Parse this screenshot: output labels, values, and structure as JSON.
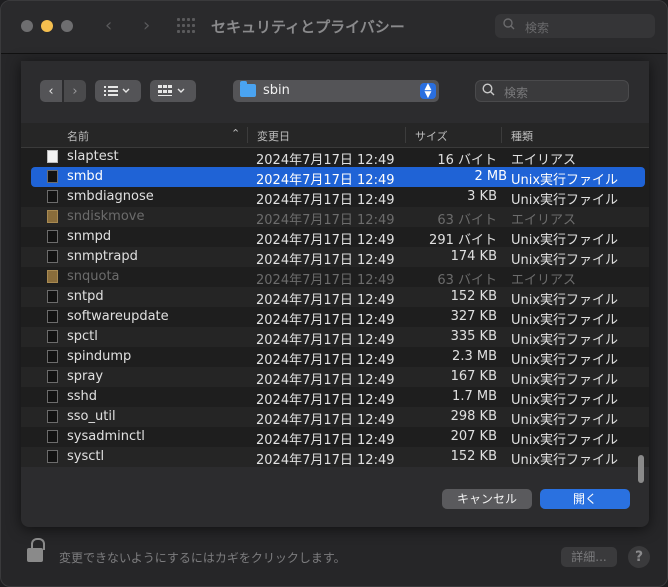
{
  "window": {
    "title": "セキュリティとプライバシー",
    "search_placeholder": "検索"
  },
  "toolbar": {
    "back_icon": "chevron-left-icon",
    "forward_icon": "chevron-right-icon",
    "list_view_icon": "list-view-icon",
    "grid_view_icon": "icon-grid-view-icon",
    "path_label": "sbin",
    "search_placeholder": "検索"
  },
  "columns": {
    "name": "名前",
    "modified": "変更日",
    "size": "サイズ",
    "kind": "種類"
  },
  "rows": [
    {
      "name": "slaptest",
      "date": "2024年7月17日 12:49",
      "size": "16 バイト",
      "kind": "エイリアス"
    },
    {
      "name": "smbd",
      "date": "2024年7月17日 12:49",
      "size": "2 MB",
      "kind": "Unix実行ファイル"
    },
    {
      "name": "smbdiagnose",
      "date": "2024年7月17日 12:49",
      "size": "3 KB",
      "kind": "Unix実行ファイル"
    },
    {
      "name": "sndiskmove",
      "date": "2024年7月17日 12:49",
      "size": "63 バイト",
      "kind": "エイリアス"
    },
    {
      "name": "snmpd",
      "date": "2024年7月17日 12:49",
      "size": "291 バイト",
      "kind": "Unix実行ファイル"
    },
    {
      "name": "snmptrapd",
      "date": "2024年7月17日 12:49",
      "size": "174 KB",
      "kind": "Unix実行ファイル"
    },
    {
      "name": "snquota",
      "date": "2024年7月17日 12:49",
      "size": "63 バイト",
      "kind": "エイリアス"
    },
    {
      "name": "sntpd",
      "date": "2024年7月17日 12:49",
      "size": "152 KB",
      "kind": "Unix実行ファイル"
    },
    {
      "name": "softwareupdate",
      "date": "2024年7月17日 12:49",
      "size": "327 KB",
      "kind": "Unix実行ファイル"
    },
    {
      "name": "spctl",
      "date": "2024年7月17日 12:49",
      "size": "335 KB",
      "kind": "Unix実行ファイル"
    },
    {
      "name": "spindump",
      "date": "2024年7月17日 12:49",
      "size": "2.3 MB",
      "kind": "Unix実行ファイル"
    },
    {
      "name": "spray",
      "date": "2024年7月17日 12:49",
      "size": "167 KB",
      "kind": "Unix実行ファイル"
    },
    {
      "name": "sshd",
      "date": "2024年7月17日 12:49",
      "size": "1.7 MB",
      "kind": "Unix実行ファイル"
    },
    {
      "name": "sso_util",
      "date": "2024年7月17日 12:49",
      "size": "298 KB",
      "kind": "Unix実行ファイル"
    },
    {
      "name": "sysadminctl",
      "date": "2024年7月17日 12:49",
      "size": "207 KB",
      "kind": "Unix実行ファイル"
    },
    {
      "name": "sysctl",
      "date": "2024年7月17日 12:49",
      "size": "152 KB",
      "kind": "Unix実行ファイル"
    }
  ],
  "buttons": {
    "cancel": "キャンセル",
    "open": "開く"
  },
  "footer": {
    "lock_text": "変更できないようにするにはカギをクリックします。",
    "details": "詳細...",
    "help": "?"
  },
  "colors": {
    "accent": "#2a71e0",
    "selection": "#1f63d6",
    "folder": "#4aa3f0"
  }
}
